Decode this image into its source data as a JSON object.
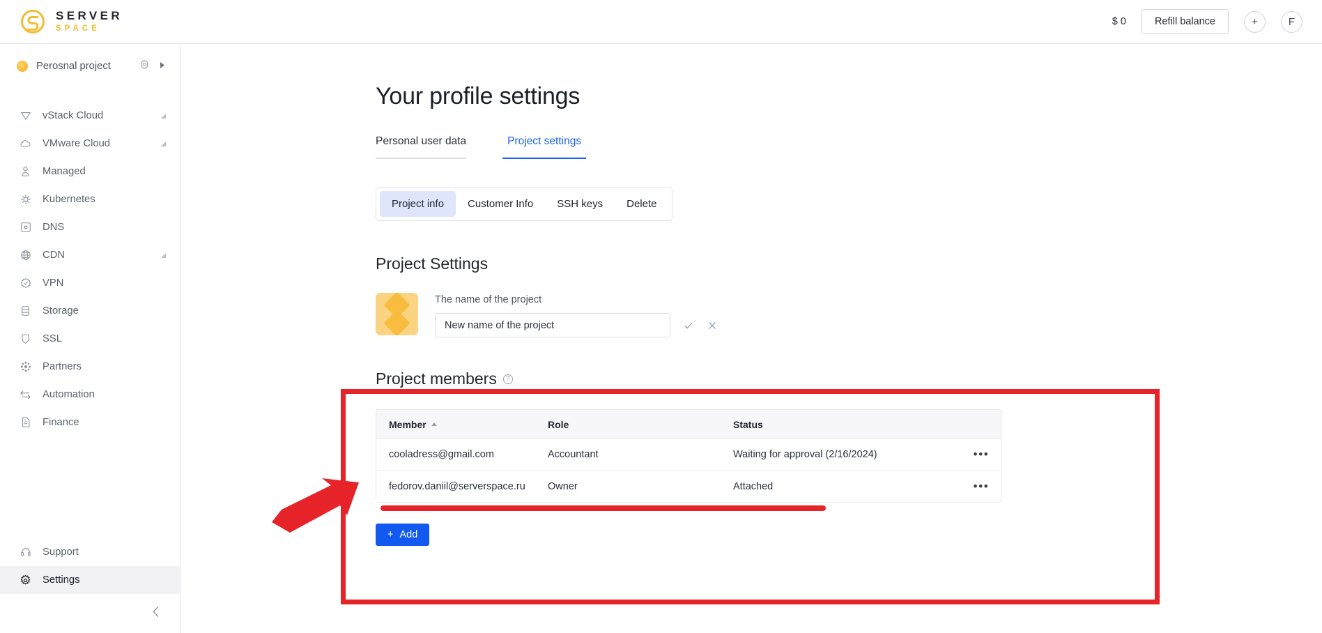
{
  "header": {
    "logo_top": "SERVER",
    "logo_bottom": "SPACE",
    "logo_icon": "serverspace-s-logo-icon",
    "balance": "$ 0",
    "refill_label": "Refill balance",
    "add_label": "+",
    "avatar_label": "F"
  },
  "sidebar": {
    "project": {
      "name": "Perosnal project",
      "gear_icon": "gear-icon",
      "expand_icon": "chevron-right-icon"
    },
    "items": [
      {
        "label": "vStack Cloud",
        "icon": "vstack-triangle-icon",
        "expandable": true,
        "active": false
      },
      {
        "label": "VMware Cloud",
        "icon": "cloud-icon",
        "expandable": true,
        "active": false
      },
      {
        "label": "Managed",
        "icon": "user-lock-icon",
        "expandable": false,
        "active": false
      },
      {
        "label": "Kubernetes",
        "icon": "kubernetes-helm-icon",
        "expandable": false,
        "active": false
      },
      {
        "label": "DNS",
        "icon": "dns-square-icon",
        "expandable": false,
        "active": false
      },
      {
        "label": "CDN",
        "icon": "globe-icon",
        "expandable": true,
        "active": false
      },
      {
        "label": "VPN",
        "icon": "vpn-badge-icon",
        "expandable": false,
        "active": false
      },
      {
        "label": "Storage",
        "icon": "database-icon",
        "expandable": false,
        "active": false
      },
      {
        "label": "SSL",
        "icon": "shield-icon",
        "expandable": false,
        "active": false
      },
      {
        "label": "Partners",
        "icon": "partners-network-icon",
        "expandable": false,
        "active": false
      },
      {
        "label": "Automation",
        "icon": "arrows-swap-icon",
        "expandable": false,
        "active": false
      },
      {
        "label": "Finance",
        "icon": "document-icon",
        "expandable": false,
        "active": false
      }
    ],
    "bottom_items": [
      {
        "label": "Support",
        "icon": "headset-icon",
        "active": false
      },
      {
        "label": "Settings",
        "icon": "gear-icon",
        "active": true
      }
    ],
    "collapse_icon": "chevron-left-icon"
  },
  "main": {
    "page_title": "Your profile settings",
    "underline_tabs": [
      {
        "label": "Personal user data",
        "active": false
      },
      {
        "label": "Project settings",
        "active": true
      }
    ],
    "segmented_tabs": [
      {
        "label": "Project info",
        "active": true
      },
      {
        "label": "Customer Info",
        "active": false
      },
      {
        "label": "SSH keys",
        "active": false
      },
      {
        "label": "Delete",
        "active": false
      }
    ],
    "project_settings": {
      "heading": "Project Settings",
      "avatar_icon": "project-diamond-avatar",
      "field_label": "The name of the project",
      "input_value": "New name of the project",
      "input_placeholder": "New name of the project",
      "confirm_icon": "check-icon",
      "cancel_icon": "close-icon"
    },
    "members": {
      "heading": "Project members",
      "help_icon": "question-mark-icon",
      "help_glyph": "?",
      "columns": [
        "Member",
        "Role",
        "Status",
        ""
      ],
      "sort_column": "Member",
      "sort_direction": "asc",
      "rows": [
        {
          "member": "cooladress@gmail.com",
          "role": "Accountant",
          "status": "Waiting for approval (2/16/2024)",
          "menu_icon": "more-options-icon",
          "menu_glyph": "•••"
        },
        {
          "member": "fedorov.daniil@serverspace.ru",
          "role": "Owner",
          "status": "Attached",
          "menu_icon": "more-options-icon",
          "menu_glyph": "•••"
        }
      ],
      "add_label": "Add",
      "add_plus": "+"
    }
  },
  "annotations": {
    "highlight_box_color": "#e52329",
    "underline_color": "#e52329",
    "arrow_color": "#e52329",
    "arrow_icon": "red-arrow-pointing-up-right",
    "box_icon": "red-highlight-rectangle",
    "underline_icon": "red-underline-stroke"
  },
  "colors": {
    "accent_blue": "#1a62f0",
    "button_blue": "#1259f0",
    "brand_yellow": "#f4bd2f",
    "annotation_red": "#e52329",
    "active_nav_bg": "#f2f2f4",
    "segment_active_bg": "#dfe6fb"
  }
}
